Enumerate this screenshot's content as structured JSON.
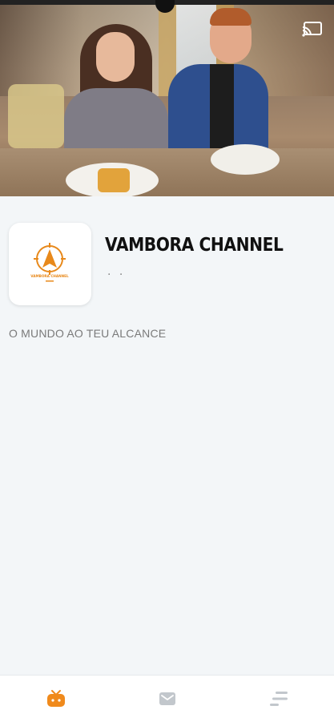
{
  "video": {
    "icons": {
      "cast": "cast-icon"
    }
  },
  "channel": {
    "logo_text": "VAMBORA CHANNEL",
    "title": "VAMBORA CHANNEL",
    "subtitle": ". .",
    "tagline": "O MUNDO AO TEU ALCANCE"
  },
  "bottom_nav": {
    "items": [
      {
        "icon": "tv-icon",
        "active": true
      },
      {
        "icon": "message-icon",
        "active": false
      },
      {
        "icon": "menu-icon",
        "active": false
      }
    ],
    "accent_color": "#f08a1c",
    "inactive_color": "#c2c7cc"
  }
}
